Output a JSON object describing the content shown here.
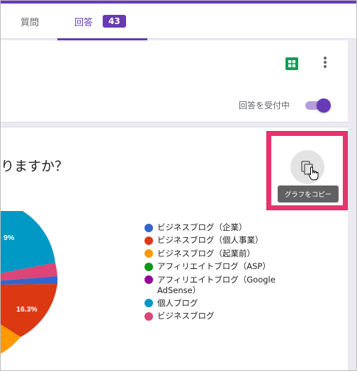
{
  "tabs": {
    "questions_label": "質問",
    "responses_label": "回答",
    "responses_count": "43"
  },
  "header": {
    "accepting_label": "回答を受付中",
    "accepting_on": true,
    "icons": [
      "sheets-icon",
      "more-vert-icon"
    ]
  },
  "question": {
    "title": "りますか？"
  },
  "copy_chart": {
    "tooltip": "グラフをコピー",
    "icon": "copy-icon"
  },
  "colors": {
    "accent": "#673ab7",
    "highlight": "#e8336d"
  },
  "chart_data": {
    "type": "pie",
    "visible_labels": [
      "9%",
      "16.3%"
    ],
    "legend": [
      {
        "label": "ビジネスブログ（企業）",
        "color": "#3366cc"
      },
      {
        "label": "ビジネスブログ（個人事業）",
        "color": "#dc3912"
      },
      {
        "label": "ビジネスブログ（起業前）",
        "color": "#ff9900"
      },
      {
        "label": "アフィリエイトブログ（ASP）",
        "color": "#109618"
      },
      {
        "label": "アフィリエイトブログ（Google AdSense）",
        "color": "#990099"
      },
      {
        "label": "個人ブログ",
        "color": "#0099c6"
      },
      {
        "label": "ビジネスブログ",
        "color": "#dd4477"
      }
    ]
  }
}
